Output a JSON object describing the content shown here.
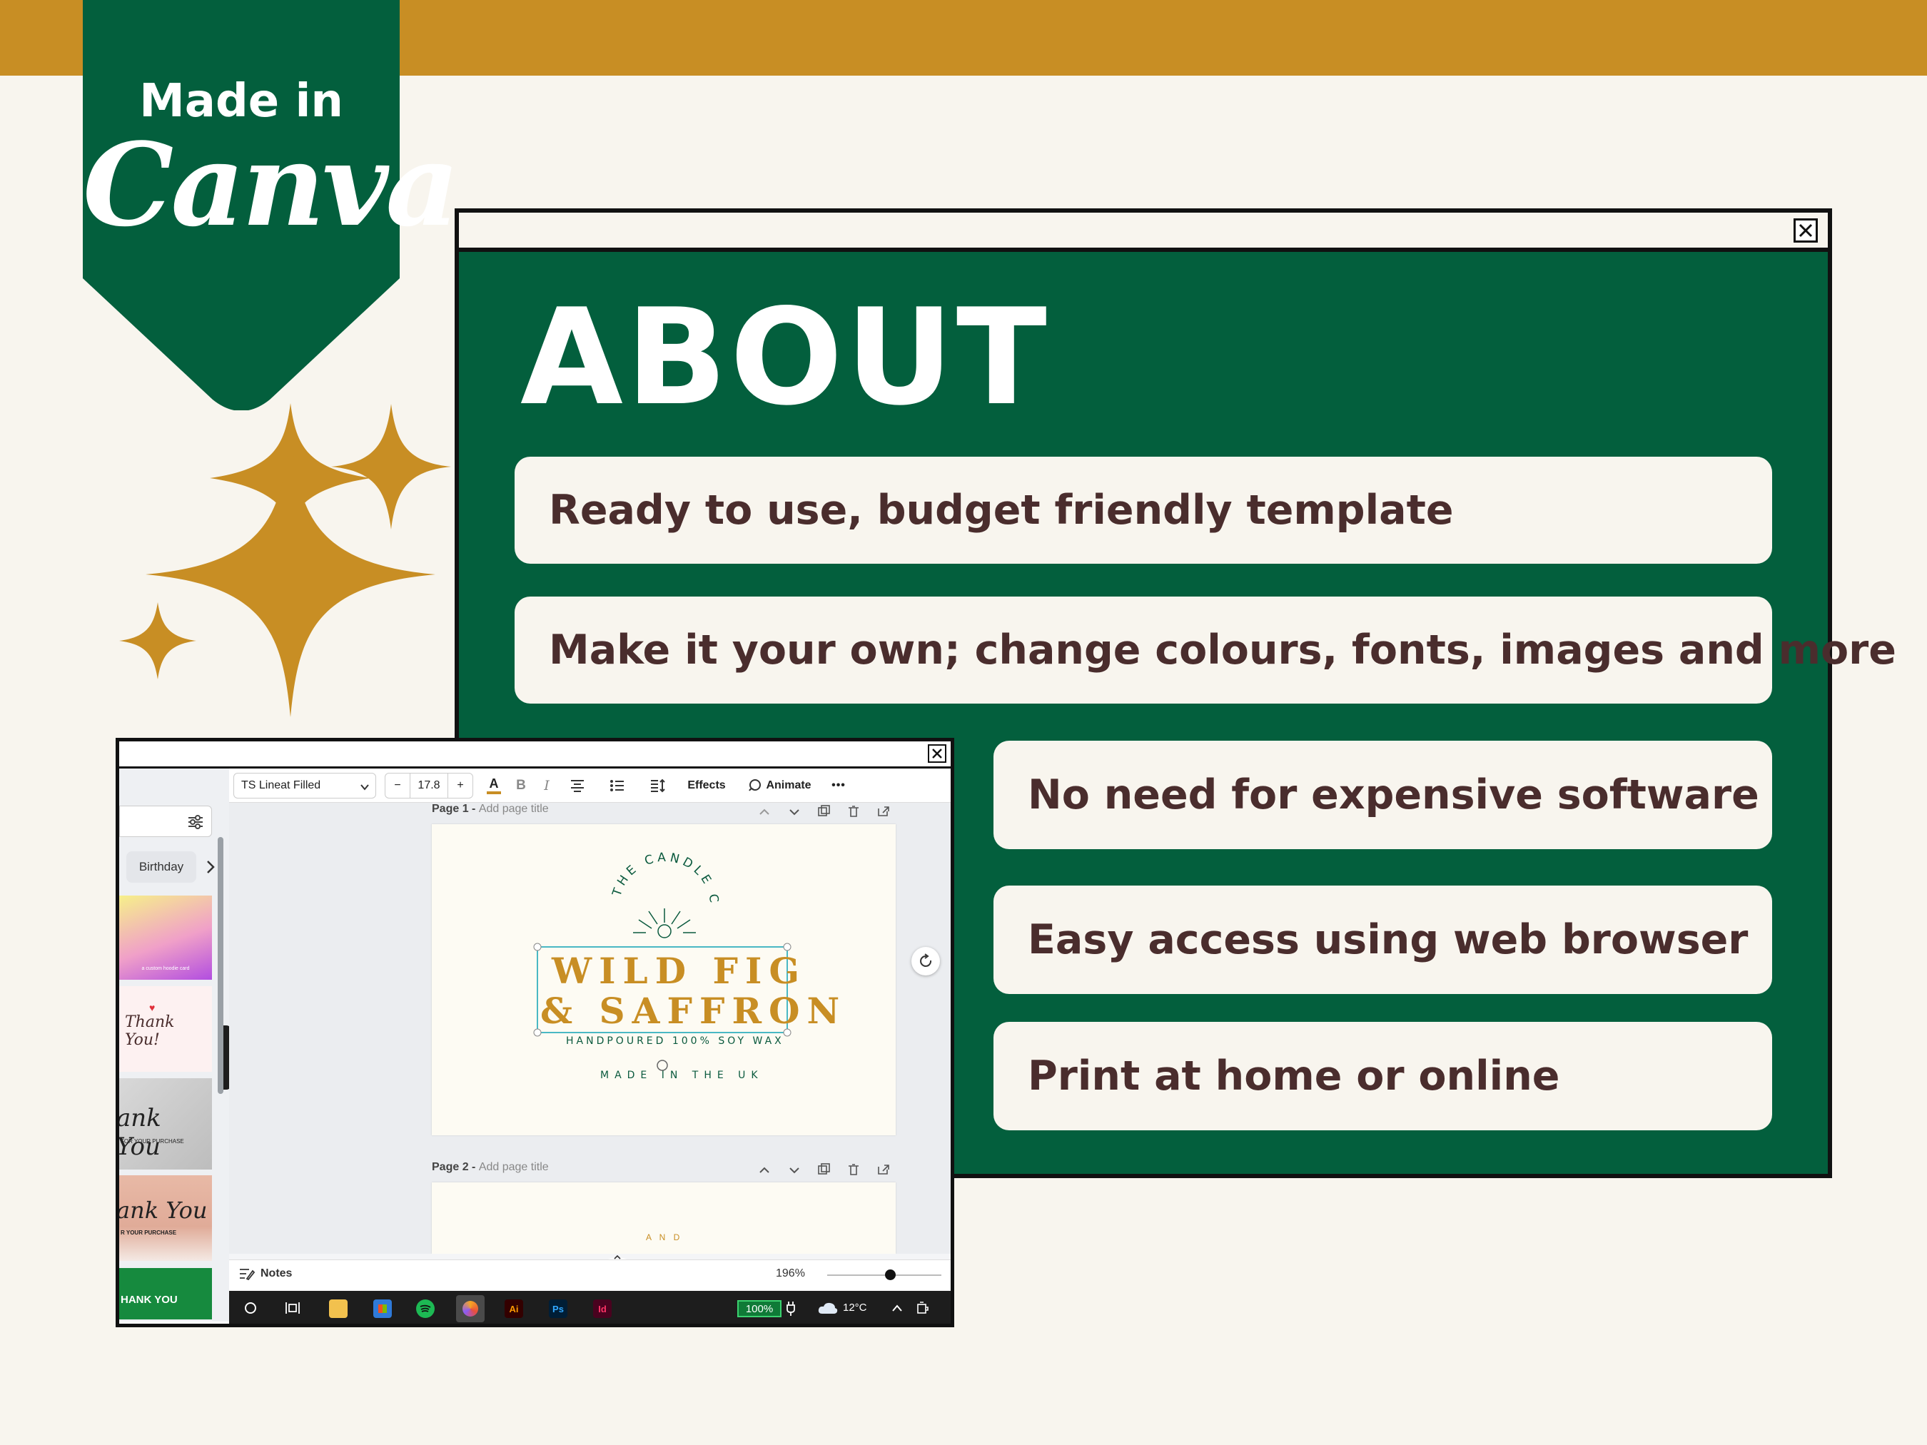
{
  "badge": {
    "line1": "Made in",
    "line2": "Canva"
  },
  "about": {
    "title": "ABOUT",
    "features": [
      "Ready to use, budget friendly template",
      "Make it your own; change colours, fonts, images and more",
      "No need for expensive software",
      "Easy access using web browser",
      "Print at home or online"
    ]
  },
  "editor": {
    "sidebar": {
      "chip": "Birthday"
    },
    "toolbar": {
      "font": "TS Lineat Filled",
      "minus": "−",
      "font_size": "17.8",
      "plus": "+",
      "text_color": "A",
      "bold": "B",
      "italic": "I",
      "effects": "Effects",
      "animate": "Animate",
      "more": "•••"
    },
    "pages": [
      {
        "label_prefix": "Page 1 - ",
        "label_placeholder": "Add page title"
      },
      {
        "label_prefix": "Page 2 - ",
        "label_placeholder": "Add page title"
      }
    ],
    "logo": {
      "arc_text": "THE CANDLE CO",
      "line1": "WILD FIG",
      "line2": "& SAFFRON",
      "tagline": "HANDPOURED 100% SOY WAX",
      "made_in": "MADE IN THE UK"
    },
    "page2_peek": "A N D",
    "bottom": {
      "notes": "Notes",
      "zoom": "196%",
      "zoom_level": 0.55
    },
    "taskbar": {
      "battery": "100%",
      "temp": "12°C"
    },
    "thumbnails": {
      "t1_caption": "a custom hoodie card",
      "t2_text": "Thank You!",
      "t3_text": "ank You",
      "t3_sub": "FOR YOUR PURCHASE",
      "t4_text": "ank You",
      "t4_sub": "R YOUR PURCHASE",
      "t5_text": "HANK YOU"
    }
  },
  "colors": {
    "gold": "#c88e24",
    "green": "#035f3d",
    "cream": "#f8f5ee",
    "text_brown": "#4a2d2d"
  }
}
